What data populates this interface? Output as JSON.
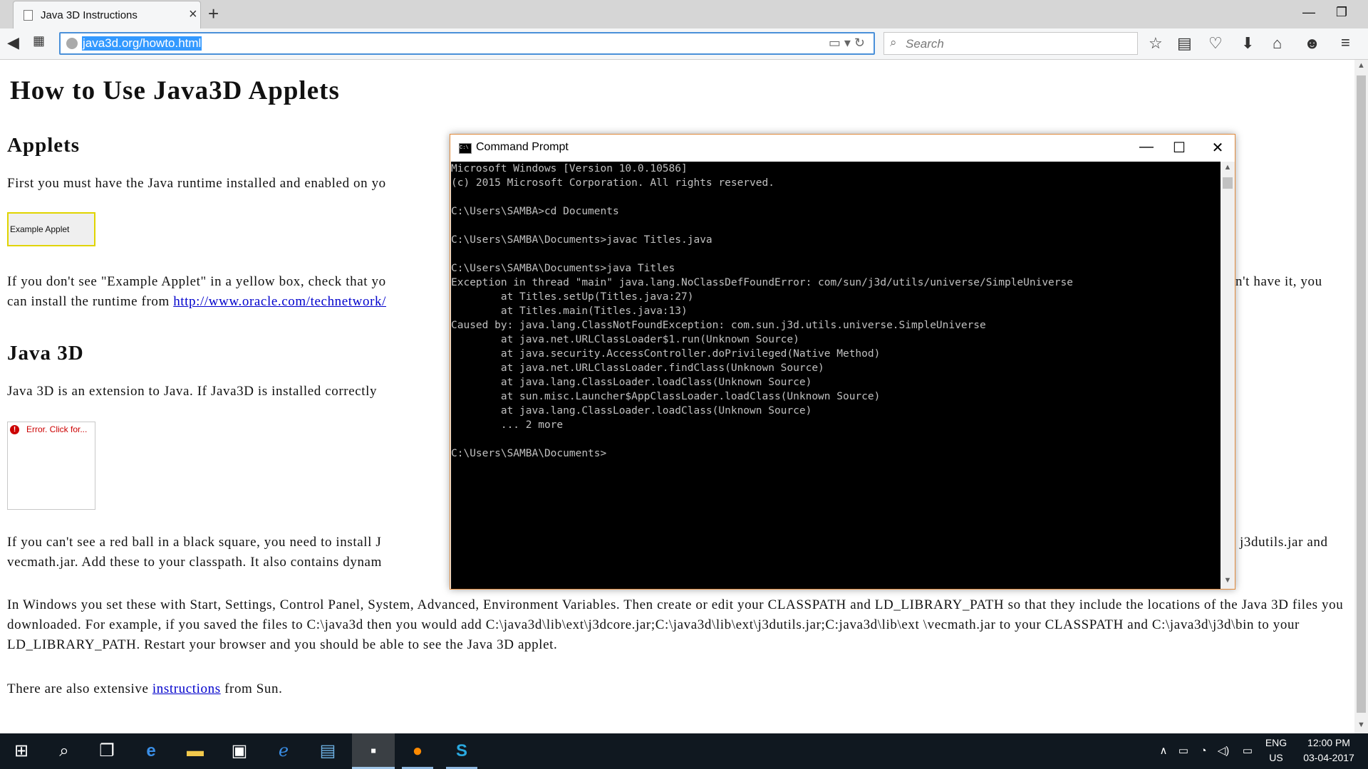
{
  "browser": {
    "tab_title": "Java 3D Instructions",
    "url": "java3d.org/howto.html",
    "search_placeholder": "Search",
    "window_controls": [
      "minimize-icon",
      "restore-icon",
      "close-icon"
    ],
    "toolbar_icons": [
      "bookmark-star-icon",
      "reading-list-icon",
      "pocket-icon",
      "download-icon",
      "home-icon",
      "hello-chat-icon",
      "menu-icon"
    ]
  },
  "page": {
    "h1": "How to Use Java3D Applets",
    "h2_applets": "Applets",
    "p1": "First you must have the Java runtime installed and enabled on yo",
    "applet_label": "Example Applet",
    "p2_a": "If you don't see \"Example Applet\" in a yellow box, check that yo",
    "p2_right": "n't have it, you",
    "p2_b": "can install the runtime from ",
    "p2_link": "http://www.oracle.com/technetwork/",
    "h2_java3d": "Java 3D",
    "p3": "Java 3D is an extension to Java. If Java3D is installed correctly",
    "error_label": "Error. Click for...",
    "p4_a": "If you can't see a red ball in a black square, you need to install J",
    "p4_right": "j3dutils.jar and",
    "p4_b": "vecmath.jar. Add these to your classpath. It also contains dynam",
    "p5": "In Windows you set these with Start, Settings, Control Panel, System, Advanced, Environment Variables. Then create or edit your CLASSPATH and LD_LIBRARY_PATH so that they include the locations of the Java 3D files you downloaded. For example, if you saved the files to C:\\java3d then you would add C:\\java3d\\lib\\ext\\j3dcore.jar;C:\\java3d\\lib\\ext\\j3dutils.jar;C:java3d\\lib\\ext \\vecmath.jar to your CLASSPATH and C:\\java3d\\j3d\\bin to your LD_LIBRARY_PATH. Restart your browser and you should be able to see the Java 3D applet.",
    "p6_a": "There are also extensive ",
    "p6_link": "instructions",
    "p6_b": " from Sun."
  },
  "cmd": {
    "title": "Command Prompt",
    "output": "Microsoft Windows [Version 10.0.10586]\n(c) 2015 Microsoft Corporation. All rights reserved.\n\nC:\\Users\\SAMBA>cd Documents\n\nC:\\Users\\SAMBA\\Documents>javac Titles.java\n\nC:\\Users\\SAMBA\\Documents>java Titles\nException in thread \"main\" java.lang.NoClassDefFoundError: com/sun/j3d/utils/universe/SimpleUniverse\n        at Titles.setUp(Titles.java:27)\n        at Titles.main(Titles.java:13)\nCaused by: java.lang.ClassNotFoundException: com.sun.j3d.utils.universe.SimpleUniverse\n        at java.net.URLClassLoader$1.run(Unknown Source)\n        at java.security.AccessController.doPrivileged(Native Method)\n        at java.net.URLClassLoader.findClass(Unknown Source)\n        at java.lang.ClassLoader.loadClass(Unknown Source)\n        at sun.misc.Launcher$AppClassLoader.loadClass(Unknown Source)\n        at java.lang.ClassLoader.loadClass(Unknown Source)\n        ... 2 more\n\nC:\\Users\\SAMBA\\Documents>"
  },
  "taskbar": {
    "apps": [
      "start-icon",
      "search-icon",
      "task-view-icon",
      "edge-icon",
      "file-explorer-icon",
      "store-icon",
      "internet-explorer-icon",
      "control-panel-icon",
      "cmd-icon",
      "firefox-icon",
      "skype-icon"
    ],
    "lang_top": "ENG",
    "lang_bottom": "US",
    "time": "12:00 PM",
    "date": "03-04-2017"
  },
  "colors": {
    "accent": "#3399ff",
    "link": "#0000cc",
    "applet_border": "#e0d400",
    "error_red": "#cc0000",
    "taskbar": "#101820",
    "console_bg": "#000000",
    "console_text": "#c0c0c0"
  }
}
